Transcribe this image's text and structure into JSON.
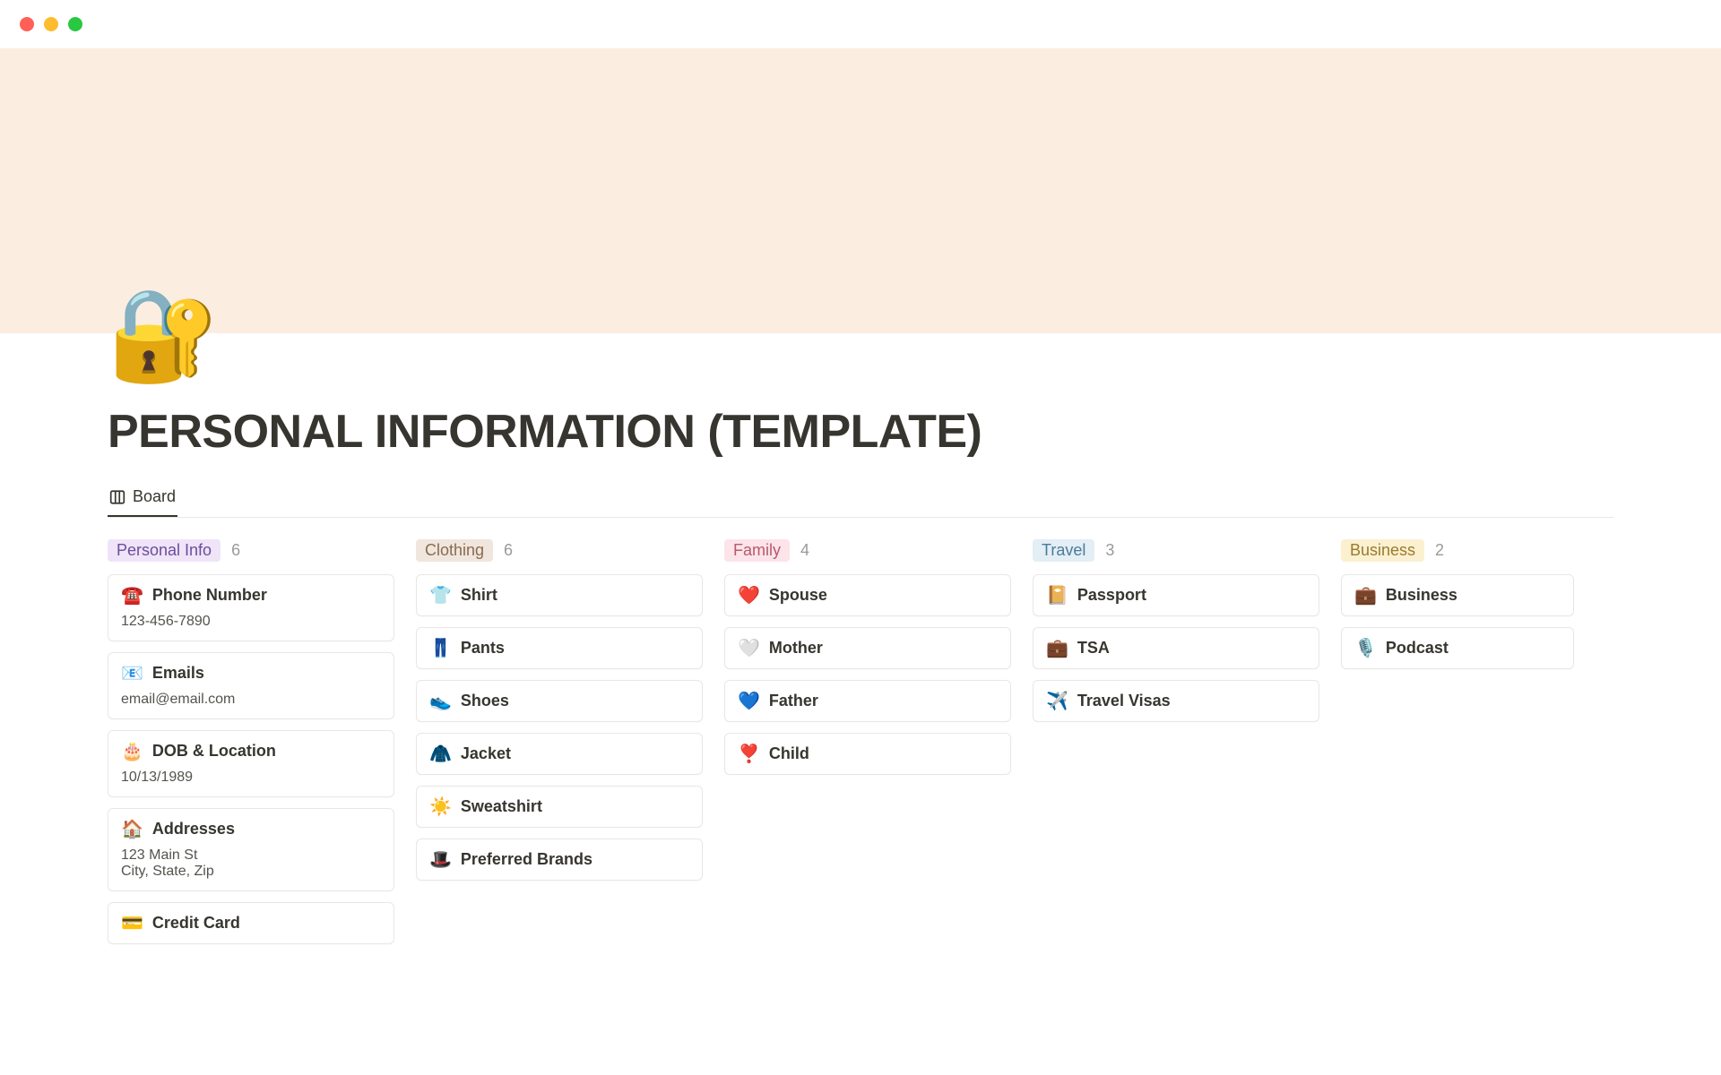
{
  "page": {
    "icon": "🔐",
    "title": "PERSONAL INFORMATION (TEMPLATE)"
  },
  "view_tab": {
    "label": "Board"
  },
  "columns": [
    {
      "tag_label": "Personal Info",
      "tag_class": "tag-purple",
      "count": "6",
      "cards": [
        {
          "emoji": "☎️",
          "title": "Phone Number",
          "sub": "123-456-7890"
        },
        {
          "emoji": "📧",
          "title": "Emails",
          "sub": "email@email.com"
        },
        {
          "emoji": "🎂",
          "title": "DOB & Location",
          "sub": "10/13/1989"
        },
        {
          "emoji": "🏠",
          "title": "Addresses",
          "sub": "123 Main St\nCity, State, Zip"
        },
        {
          "emoji": "💳",
          "title": "Credit Card",
          "sub": ""
        }
      ]
    },
    {
      "tag_label": "Clothing",
      "tag_class": "tag-brown",
      "count": "6",
      "cards": [
        {
          "emoji": "👕",
          "title": "Shirt",
          "sub": ""
        },
        {
          "emoji": "👖",
          "title": "Pants",
          "sub": ""
        },
        {
          "emoji": "👟",
          "title": "Shoes",
          "sub": ""
        },
        {
          "emoji": "🧥",
          "title": "Jacket",
          "sub": ""
        },
        {
          "emoji": "☀️",
          "title": "Sweatshirt",
          "sub": ""
        },
        {
          "emoji": "🎩",
          "title": "Preferred Brands",
          "sub": ""
        }
      ]
    },
    {
      "tag_label": "Family",
      "tag_class": "tag-pink",
      "count": "4",
      "cards": [
        {
          "emoji": "❤️",
          "title": "Spouse",
          "sub": ""
        },
        {
          "emoji": "🤍",
          "title": "Mother",
          "sub": ""
        },
        {
          "emoji": "💙",
          "title": "Father",
          "sub": ""
        },
        {
          "emoji": "❣️",
          "title": "Child",
          "sub": ""
        }
      ]
    },
    {
      "tag_label": "Travel",
      "tag_class": "tag-blue",
      "count": "3",
      "cards": [
        {
          "emoji": "📔",
          "title": "Passport",
          "sub": ""
        },
        {
          "emoji": "💼",
          "title": "TSA",
          "sub": ""
        },
        {
          "emoji": "✈️",
          "title": "Travel Visas",
          "sub": ""
        }
      ]
    },
    {
      "tag_label": "Business",
      "tag_class": "tag-yellow",
      "count": "2",
      "cards": [
        {
          "emoji": "💼",
          "title": "Business",
          "sub": ""
        },
        {
          "emoji": "🎙️",
          "title": "Podcast",
          "sub": ""
        }
      ]
    }
  ]
}
